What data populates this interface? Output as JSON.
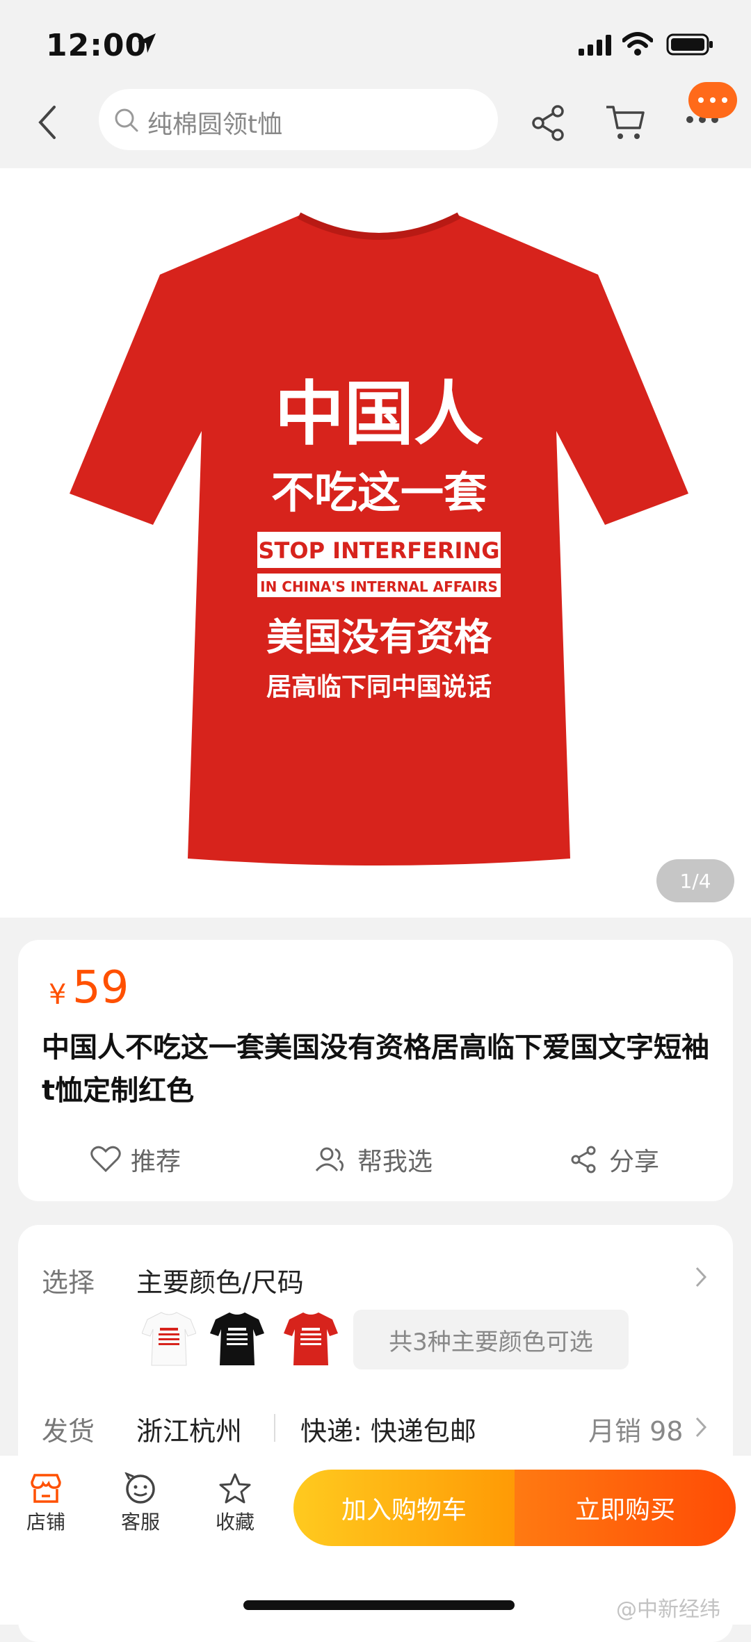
{
  "status": {
    "time": "12:00"
  },
  "nav": {
    "search_placeholder": "纯棉圆领t恤"
  },
  "gallery": {
    "pager": "1/4",
    "shirt_text": {
      "line1": "中国人",
      "line2": "不吃这一套",
      "line3": "STOP INTERFERING",
      "line4": "IN CHINA'S INTERNAL AFFAIRS",
      "line5": "美国没有资格",
      "line6": "居高临下同中国说话"
    },
    "shirt_color": "#d7231c"
  },
  "product": {
    "currency": "¥",
    "price": "59",
    "title": "中国人不吃这一套美国没有资格居高临下爱国文字短袖t恤定制红色",
    "actions": {
      "recommend": "推荐",
      "help_choose": "帮我选",
      "share": "分享"
    }
  },
  "options": {
    "select_label": "选择",
    "select_value": "主要颜色/尺码",
    "colors_note": "共3种主要颜色可选",
    "ship_label": "发货",
    "ship_from": "浙江杭州",
    "ship_method": "快递: 快递包邮",
    "monthly_sales": "月销 98"
  },
  "bottom": {
    "store": "店铺",
    "service": "客服",
    "favorite": "收藏",
    "add_cart": "加入购物车",
    "buy_now": "立即购买"
  },
  "watermark": "@中新经纬",
  "colors": {
    "accent": "#ff5000",
    "badge": "#ff6a1a"
  }
}
